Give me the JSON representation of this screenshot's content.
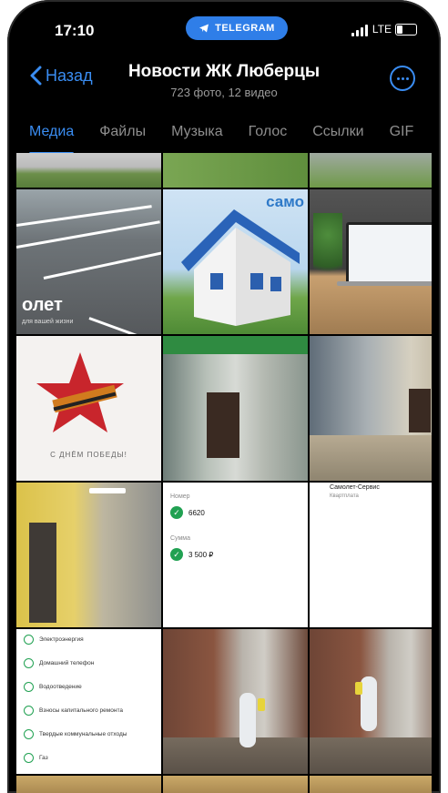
{
  "status": {
    "time": "17:10",
    "pill": "TELEGRAM",
    "network": "LTE"
  },
  "header": {
    "back_label": "Назад",
    "title": "Новости ЖК Люберцы",
    "subtitle": "723 фото, 12 видео"
  },
  "tabs": [
    {
      "label": "Медиа"
    },
    {
      "label": "Файлы"
    },
    {
      "label": "Музыка"
    },
    {
      "label": "Голос"
    },
    {
      "label": "Ссылки"
    },
    {
      "label": "GIF"
    }
  ],
  "media": {
    "parking_logo": "олет",
    "parking_logo_sub": "для вашей жизни",
    "house_brand": "само",
    "star_caption": "С ДНЁМ ПОБЕДЫ!",
    "form": {
      "label1": "Номер",
      "value1": "6620",
      "label2": "Сумма",
      "value2": "3 500 ₽"
    },
    "doc": {
      "line1": "Самолет-Сервис",
      "line2": "Квартплата"
    },
    "list_items": [
      "Электроэнергия",
      "Домашний телефон",
      "Водоотведение",
      "Взносы капитального ремонта",
      "Твердые коммунальные отходы",
      "Газ"
    ]
  }
}
